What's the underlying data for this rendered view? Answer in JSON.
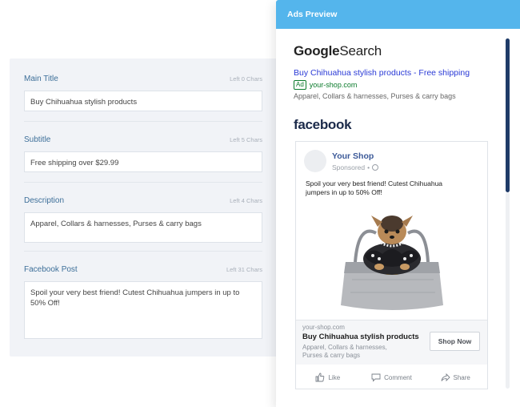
{
  "form": {
    "fields": [
      {
        "label": "Main Title",
        "count": "Left 0 Chars",
        "value": "Buy Chihuahua stylish products"
      },
      {
        "label": "Subtitle",
        "count": "Left 5 Chars",
        "value": "Free shipping over $29.99"
      },
      {
        "label": "Description",
        "count": "Left 4 Chars",
        "value": "Apparel, Collars & harnesses, Purses & carry bags"
      },
      {
        "label": "Facebook Post",
        "count": "Left 31 Chars",
        "value": "Spoil your very best friend! Cutest Chihuahua jumpers in up to 50% Off!"
      }
    ]
  },
  "preview": {
    "header": "Ads Preview",
    "google": {
      "logo_google": "Google",
      "logo_search": "Search",
      "title": "Buy Chihuahua stylish products - Free shipping",
      "ad_badge": "Ad",
      "url": "your-shop.com",
      "description": "Apparel, Collars & harnesses, Purses & carry bags"
    },
    "facebook": {
      "logo": "facebook",
      "page_name": "Your Shop",
      "sponsored": "Sponsored",
      "post_text": "Spoil your very best friend! Cutest Chihuahua jumpers in up to 50% Off!",
      "domain": "your-shop.com",
      "headline": "Buy Chihuahua stylish products",
      "link_description": "Apparel, Collars & harnesses, Purses & carry bags",
      "cta": "Shop Now",
      "actions": {
        "like": "Like",
        "comment": "Comment",
        "share": "Share"
      }
    }
  },
  "colors": {
    "header": "#54b5ec",
    "label": "#3d6f99",
    "google_link": "#2a3ad6",
    "google_url": "#0a7a2b",
    "facebook_page": "#3b5998"
  }
}
